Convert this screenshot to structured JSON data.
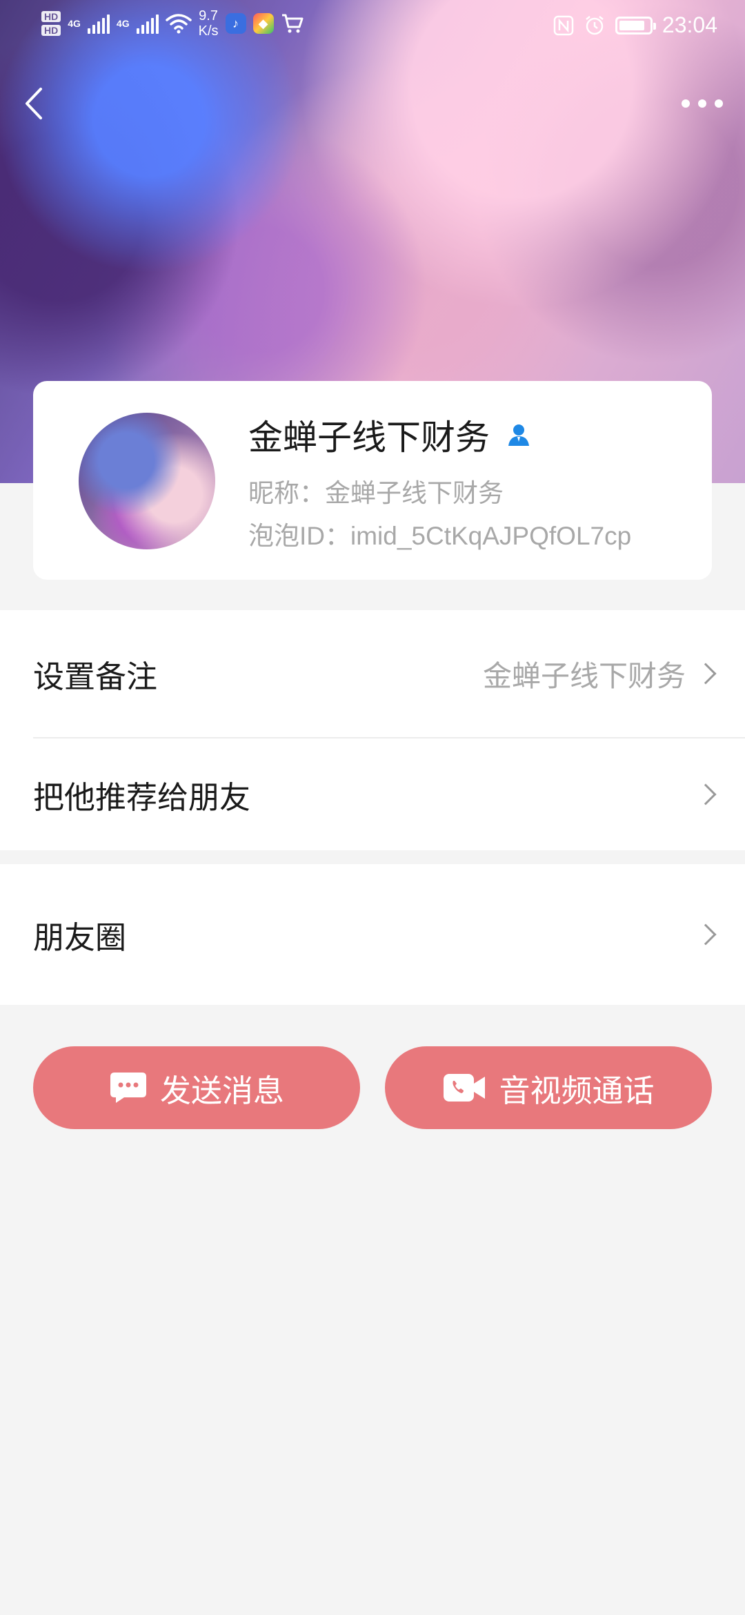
{
  "status_bar": {
    "net_speed_value": "9.7",
    "net_speed_unit": "K/s",
    "network_1": "4G",
    "network_2": "4G",
    "time": "23:04",
    "battery_level": 0.85,
    "hd_1": "HD",
    "hd_2": "HD"
  },
  "nav": {
    "back_icon": "chevron-left-icon",
    "more_icon": "more-dots-icon"
  },
  "profile": {
    "display_name": "金蝉子线下财务",
    "nickname_label": "昵称：",
    "nickname": "金蝉子线下财务",
    "id_label": "泡泡ID：",
    "id_value": "imid_5CtKqAJPQfOL7cp",
    "person_icon": "person-icon",
    "accent_color": "#1e88e5"
  },
  "menu": {
    "remark_label": "设置备注",
    "remark_value": "金蝉子线下财务",
    "recommend_label": "把他推荐给朋友",
    "moments_label": "朋友圈"
  },
  "actions": {
    "send_message": "发送消息",
    "av_call": "音视频通话",
    "button_color": "#e8787c"
  }
}
